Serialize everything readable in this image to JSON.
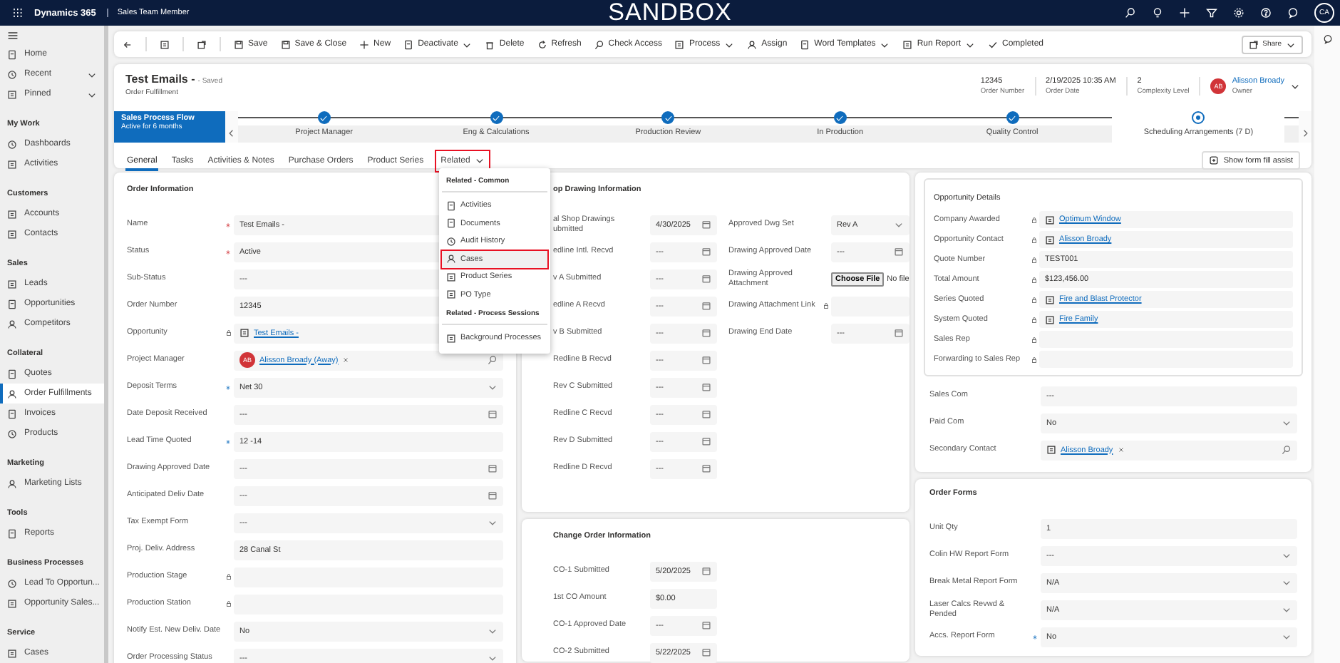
{
  "top_bar": {
    "app_name": "Dynamics 365",
    "area": "Sales Team Member",
    "environment": "SANDBOX",
    "user_initials": "CA"
  },
  "sidebar": {
    "groups": [
      {
        "items": [
          {
            "label": "Home",
            "kind": "link",
            "selected": false
          },
          {
            "label": "Recent",
            "kind": "flyout",
            "selected": false
          },
          {
            "label": "Pinned",
            "kind": "flyout",
            "selected": false
          }
        ]
      },
      {
        "heading": "My Work",
        "items": [
          {
            "label": "Dashboards",
            "kind": "link",
            "selected": false
          },
          {
            "label": "Activities",
            "kind": "link",
            "selected": false
          }
        ]
      },
      {
        "heading": "Customers",
        "items": [
          {
            "label": "Accounts",
            "kind": "link",
            "selected": false
          },
          {
            "label": "Contacts",
            "kind": "link",
            "selected": false
          }
        ]
      },
      {
        "heading": "Sales",
        "items": [
          {
            "label": "Leads",
            "kind": "link",
            "selected": false
          },
          {
            "label": "Opportunities",
            "kind": "link",
            "selected": false
          },
          {
            "label": "Competitors",
            "kind": "link",
            "selected": false
          }
        ]
      },
      {
        "heading": "Collateral",
        "items": [
          {
            "label": "Quotes",
            "kind": "link",
            "selected": false
          },
          {
            "label": "Order Fulfillments",
            "kind": "link",
            "selected": true
          },
          {
            "label": "Invoices",
            "kind": "link",
            "selected": false
          },
          {
            "label": "Products",
            "kind": "link",
            "selected": false
          }
        ]
      },
      {
        "heading": "Marketing",
        "items": [
          {
            "label": "Marketing Lists",
            "kind": "link",
            "selected": false
          }
        ]
      },
      {
        "heading": "Tools",
        "items": [
          {
            "label": "Reports",
            "kind": "link",
            "selected": false
          }
        ]
      },
      {
        "heading": "Business Processes",
        "items": [
          {
            "label": "Lead To Opportun...",
            "kind": "link",
            "selected": false
          },
          {
            "label": "Opportunity Sales...",
            "kind": "link",
            "selected": false
          }
        ]
      },
      {
        "heading": "Service",
        "items": [
          {
            "label": "Cases",
            "kind": "link",
            "selected": false
          }
        ]
      }
    ]
  },
  "command_bar": {
    "commands": [
      {
        "label": "Save",
        "kind": "button"
      },
      {
        "label": "Save & Close",
        "kind": "button"
      },
      {
        "label": "New",
        "kind": "button"
      },
      {
        "label": "Deactivate",
        "kind": "dropdown"
      },
      {
        "label": "Delete",
        "kind": "button"
      },
      {
        "label": "Refresh",
        "kind": "button"
      },
      {
        "label": "Check Access",
        "kind": "button"
      },
      {
        "label": "Process",
        "kind": "dropdown"
      },
      {
        "label": "Assign",
        "kind": "button"
      },
      {
        "label": "Word Templates",
        "kind": "dropdown"
      },
      {
        "label": "Run Report",
        "kind": "dropdown"
      },
      {
        "label": "Completed",
        "kind": "button"
      }
    ],
    "share": "Share"
  },
  "record": {
    "title": "Test Emails -",
    "status": "- Saved",
    "entity": "Order Fulfillment",
    "header_fields": [
      {
        "value": "12345",
        "label": "Order Number"
      },
      {
        "value": "2/19/2025 10:35 AM",
        "label": "Order Date"
      },
      {
        "value": "2",
        "label": "Complexity Level"
      }
    ],
    "owner": {
      "initials": "AB",
      "name": "Alisson Broady",
      "label": "Owner"
    }
  },
  "process_flow": {
    "name": "Sales Process Flow",
    "duration": "Active for 6 months",
    "stages": [
      {
        "label": "Project Manager",
        "completed": true,
        "active": false
      },
      {
        "label": "Eng & Calculations",
        "completed": true,
        "active": false
      },
      {
        "label": "Production Review",
        "completed": true,
        "active": false
      },
      {
        "label": "In Production",
        "completed": true,
        "active": false
      },
      {
        "label": "Quality Control",
        "completed": true,
        "active": false
      },
      {
        "label": "Scheduling Arrangements  (7 D)",
        "completed": false,
        "active": true
      }
    ]
  },
  "tabs": [
    {
      "label": "General",
      "selected": true,
      "menu": false,
      "highlighted": false
    },
    {
      "label": "Tasks",
      "selected": false,
      "menu": false,
      "highlighted": false
    },
    {
      "label": "Activities & Notes",
      "selected": false,
      "menu": false,
      "highlighted": false
    },
    {
      "label": "Purchase Orders",
      "selected": false,
      "menu": false,
      "highlighted": false
    },
    {
      "label": "Product Series",
      "selected": false,
      "menu": false,
      "highlighted": false
    },
    {
      "label": "Related",
      "selected": false,
      "menu": true,
      "highlighted": true
    }
  ],
  "form_fill_assist": "Show form fill assist",
  "related_menu": {
    "sections": [
      {
        "heading": "Related - Common",
        "items": [
          {
            "label": "Activities",
            "highlighted": false
          },
          {
            "label": "Documents",
            "highlighted": false
          },
          {
            "label": "Audit History",
            "highlighted": false
          },
          {
            "label": "Cases",
            "highlighted": true
          },
          {
            "label": "Product Series",
            "highlighted": false
          },
          {
            "label": "PO Type",
            "highlighted": false
          }
        ]
      },
      {
        "heading": "Related - Process Sessions",
        "items": [
          {
            "label": "Background Processes",
            "highlighted": false
          }
        ]
      }
    ]
  },
  "order_information": {
    "title": "Order Information",
    "fields": [
      {
        "label": "Name",
        "required": true,
        "recommended": false,
        "locked": false,
        "kind": "text",
        "value": "Test Emails -"
      },
      {
        "label": "Status",
        "required": true,
        "recommended": false,
        "locked": false,
        "kind": "text",
        "value": "Active"
      },
      {
        "label": "Sub-Status",
        "required": false,
        "recommended": false,
        "locked": false,
        "kind": "text",
        "value": "---"
      },
      {
        "label": "Order Number",
        "required": false,
        "recommended": false,
        "locked": false,
        "kind": "text",
        "value": "12345"
      },
      {
        "label": "Opportunity",
        "required": false,
        "recommended": false,
        "locked": true,
        "kind": "link",
        "value": "Test Emails -"
      },
      {
        "label": "Project Manager",
        "required": false,
        "recommended": false,
        "locked": false,
        "kind": "lookup",
        "avatar": "AB",
        "value": "Alisson Broady (Away)"
      },
      {
        "label": "Deposit Terms",
        "required": false,
        "recommended": true,
        "locked": false,
        "kind": "select",
        "value": "Net 30"
      },
      {
        "label": "Date Deposit Received",
        "required": false,
        "recommended": false,
        "locked": false,
        "kind": "date",
        "value": "---"
      },
      {
        "label": "Lead Time Quoted",
        "required": false,
        "recommended": true,
        "locked": false,
        "kind": "text",
        "value": "12 -14"
      },
      {
        "label": "Drawing Approved Date",
        "required": false,
        "recommended": false,
        "locked": false,
        "kind": "date",
        "value": "---"
      },
      {
        "label": "Anticipated Deliv Date",
        "required": false,
        "recommended": false,
        "locked": false,
        "kind": "date",
        "value": "---"
      },
      {
        "label": "Tax Exempt Form",
        "required": false,
        "recommended": false,
        "locked": false,
        "kind": "select",
        "value": "---"
      },
      {
        "label": "Proj. Deliv. Address",
        "required": false,
        "recommended": false,
        "locked": false,
        "kind": "text",
        "value": "28 Canal St"
      },
      {
        "label": "Production Stage",
        "required": false,
        "recommended": false,
        "locked": true,
        "kind": "text"
      },
      {
        "label": "Production Station",
        "required": false,
        "recommended": false,
        "locked": true,
        "kind": "text"
      },
      {
        "label": "Notify Est. New Deliv. Date",
        "required": false,
        "recommended": false,
        "locked": false,
        "kind": "select",
        "value": "No"
      },
      {
        "label": "Order Processing Status",
        "required": false,
        "recommended": false,
        "locked": false,
        "kind": "select",
        "value": "---"
      }
    ]
  },
  "shop_drawing": {
    "title": "op Drawing Information",
    "fields_left": [
      {
        "label": "al Shop Drawings ubmitted",
        "kind": "date",
        "value": "4/30/2025"
      },
      {
        "label": "edline Intl. Recvd",
        "kind": "date",
        "value": "---"
      },
      {
        "label": "v A Submitted",
        "kind": "date",
        "value": "---"
      },
      {
        "label": "edline A Recvd",
        "kind": "date",
        "value": "---"
      },
      {
        "label": "v B Submitted",
        "kind": "date",
        "value": "---"
      },
      {
        "label": "Redline B Recvd",
        "kind": "date",
        "value": "---"
      },
      {
        "label": "Rev C Submitted",
        "kind": "date",
        "value": "---"
      },
      {
        "label": "Redline C Recvd",
        "kind": "date",
        "value": "---"
      },
      {
        "label": "Rev D Submitted",
        "kind": "date",
        "value": "---"
      },
      {
        "label": "Redline D Recvd",
        "kind": "date",
        "value": "---"
      }
    ],
    "fields_right": [
      {
        "label": "Approved Dwg Set",
        "locked": false,
        "kind": "select",
        "value": "Rev A"
      },
      {
        "label": "Drawing Approved Date",
        "locked": false,
        "kind": "date",
        "value": "---"
      },
      {
        "label": "Drawing Approved Attachment",
        "locked": false,
        "kind": "file",
        "button": "Choose File",
        "value": "No file"
      },
      {
        "label": "Drawing Attachment Link",
        "locked": true,
        "kind": "text"
      },
      {
        "label": "Drawing End Date",
        "locked": false,
        "kind": "date",
        "value": "---"
      }
    ]
  },
  "change_order": {
    "title": "Change Order Information",
    "fields": [
      {
        "label": "CO-1 Submitted",
        "kind": "date",
        "value": "5/20/2025"
      },
      {
        "label": "1st CO Amount",
        "kind": "text",
        "value": "$0.00"
      },
      {
        "label": "CO-1 Approved Date",
        "kind": "date",
        "value": "---"
      },
      {
        "label": "CO-2 Submitted",
        "kind": "date",
        "value": "5/22/2025"
      }
    ]
  },
  "opportunity_details": {
    "title": "Opportunity Details",
    "fields": [
      {
        "label": "Company Awarded",
        "locked": true,
        "kind": "link",
        "value": "Optimum Window"
      },
      {
        "label": "Opportunity Contact",
        "locked": true,
        "kind": "link",
        "value": "Alisson Broady"
      },
      {
        "label": "Quote Number",
        "locked": true,
        "kind": "text",
        "value": "TEST001"
      },
      {
        "label": "Total Amount",
        "locked": true,
        "kind": "text",
        "value": "$123,456.00"
      },
      {
        "label": "Series Quoted",
        "locked": true,
        "kind": "link",
        "value": "Fire and Blast Protector"
      },
      {
        "label": "System Quoted",
        "locked": true,
        "kind": "link",
        "value": "Fire Family"
      },
      {
        "label": "Sales Rep",
        "locked": true,
        "kind": "text"
      },
      {
        "label": "Forwarding to Sales Rep",
        "locked": true,
        "kind": "text"
      }
    ],
    "more_fields": [
      {
        "label": "Sales Com",
        "kind": "text",
        "value": "---"
      },
      {
        "label": "Paid Com",
        "kind": "select",
        "value": "No"
      },
      {
        "label": "Secondary Contact",
        "kind": "lookup",
        "value": "Alisson Broady"
      }
    ]
  },
  "order_forms": {
    "title": "Order Forms",
    "fields": [
      {
        "label": "Unit Qty",
        "recommended": false,
        "kind": "text",
        "value": "1"
      },
      {
        "label": "Colin HW Report Form",
        "recommended": false,
        "kind": "select",
        "value": "---"
      },
      {
        "label": "Break Metal Report Form",
        "recommended": false,
        "kind": "select",
        "value": "N/A"
      },
      {
        "label": "Laser Calcs Revwd & Pended",
        "recommended": false,
        "kind": "select",
        "value": "N/A"
      },
      {
        "label": "Accs. Report Form",
        "recommended": true,
        "kind": "select",
        "value": "No"
      }
    ]
  }
}
